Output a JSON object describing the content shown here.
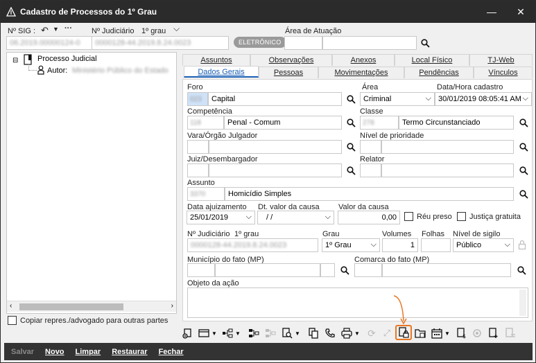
{
  "window": {
    "title": "Cadastro de Processos do 1º Grau"
  },
  "header": {
    "nsig_label": "Nº SIG :",
    "nsig_value": "06.2019.00000124-0",
    "njud_label": "Nº Judiciário",
    "njud_grau": "1º grau",
    "njud_value": "0000128-44.2019.8.24.0023",
    "badge": "ELETRÔNICO",
    "area_label": "Área de Atuação",
    "area_value": ""
  },
  "tree": {
    "root": "Processo Judicial",
    "child_label": "Autor:",
    "child_value": "Ministério Público do Estado"
  },
  "copy_checkbox": "Copiar repres./advogado para outras partes",
  "tabs_top": [
    "Assuntos",
    "Observações",
    "Anexos",
    "Local Físico",
    "TJ-Web"
  ],
  "tabs_bottom": [
    "Dados Gerais",
    "Pessoas",
    "Movimentações",
    "Pendências",
    "Vínculos"
  ],
  "form": {
    "foro_label": "Foro",
    "foro_code": "023",
    "foro_value": "Capital",
    "area_label": "Área",
    "area_value": "Criminal",
    "data_cadastro_label": "Data/Hora cadastro",
    "data_cadastro_value": "30/01/2019 08:05:41 AM",
    "competencia_label": "Competência",
    "competencia_code": "118",
    "competencia_value": "Penal - Comum",
    "classe_label": "Classe",
    "classe_code": "278",
    "classe_value": "Termo Circunstanciado",
    "vara_label": "Vara/Órgão Julgador",
    "nivel_prioridade_label": "Nível de prioridade",
    "juiz_label": "Juiz/Desembargador",
    "relator_label": "Relator",
    "assunto_label": "Assunto",
    "assunto_code": "3370",
    "assunto_value": "Homicídio Simples",
    "data_ajuiz_label": "Data ajuizamento",
    "data_ajuiz_value": "25/01/2019",
    "dt_valor_label": "Dt. valor da causa",
    "dt_valor_value": "/ /",
    "valor_causa_label": "Valor da causa",
    "valor_causa_value": "0,00",
    "reu_preso_label": "Réu preso",
    "justica_gratuita_label": "Justiça gratuita",
    "njud2_label": "Nº Judiciário",
    "njud2_grau": "1º grau",
    "njud2_value": "0000128-44.2019.8.24.0023",
    "grau_label": "Grau",
    "grau_value": "1º Grau",
    "volumes_label": "Volumes",
    "volumes_value": "1",
    "folhas_label": "Folhas",
    "sigilo_label": "Nível de sigilo",
    "sigilo_value": "Público",
    "municipio_label": "Município do fato (MP)",
    "comarca_label": "Comarca do fato (MP)",
    "objeto_label": "Objeto da ação"
  },
  "bottom": {
    "salvar": "Salvar",
    "novo": "Novo",
    "limpar": "Limpar",
    "restaurar": "Restaurar",
    "fechar": "Fechar"
  },
  "colors": {
    "accent": "#1a5fb4",
    "highlight": "#e87722",
    "titlebar": "#2b2b2b"
  }
}
